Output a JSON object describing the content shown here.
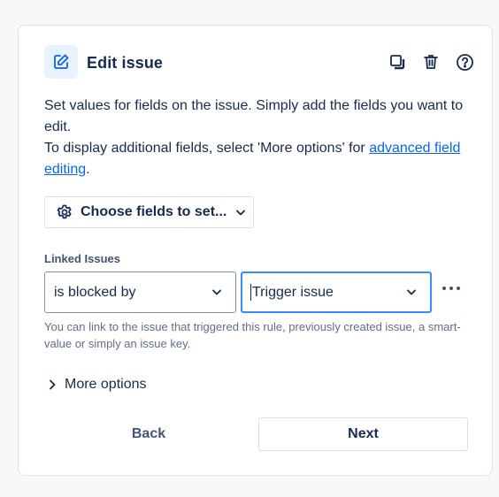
{
  "header": {
    "title": "Edit issue",
    "icons": [
      "edit-icon",
      "duplicate-icon",
      "trash-icon",
      "help-icon"
    ]
  },
  "description": {
    "line1": "Set values for fields on the issue. Simply add the fields you want to edit.",
    "line2_prefix": "To display additional fields, select 'More options' for ",
    "link_text": "advanced field editing",
    "line2_suffix": "."
  },
  "choose_fields": {
    "label": "Choose fields to set..."
  },
  "linked_issues": {
    "label": "Linked Issues",
    "link_type": "is blocked by",
    "target": "Trigger issue",
    "help_text": "You can link to the issue that triggered this rule, previously created issue, a smart-value or simply an issue key."
  },
  "more_options": {
    "label": "More options"
  },
  "footer": {
    "back_label": "Back",
    "next_label": "Next"
  },
  "colors": {
    "accent": "#0c66e4",
    "focus_border": "#388bff",
    "badge_bg": "#e9f2ff"
  }
}
